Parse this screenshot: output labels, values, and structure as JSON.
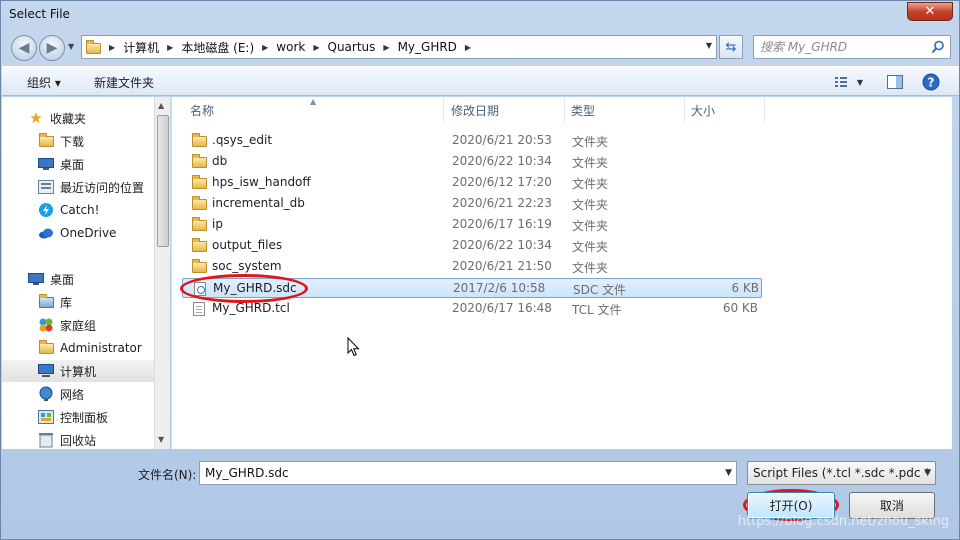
{
  "window": {
    "title": "Select File",
    "close_glyph": "✕"
  },
  "address": {
    "crumbs": [
      "计算机",
      "本地磁盘 (E:)",
      "work",
      "Quartus",
      "My_GHRD"
    ],
    "search_placeholder": "搜索 My_GHRD"
  },
  "toolbar": {
    "organize": "组织 ▾",
    "new_folder": "新建文件夹"
  },
  "nav": {
    "favorites": {
      "label": "收藏夹",
      "items": [
        "下载",
        "桌面",
        "最近访问的位置",
        "Catch!",
        "OneDrive"
      ]
    },
    "desktop": {
      "label": "桌面",
      "items": [
        "库",
        "家庭组",
        "Administrator",
        "计算机",
        "网络",
        "控制面板",
        "回收站"
      ]
    }
  },
  "columns": {
    "name": "名称",
    "modified": "修改日期",
    "type": "类型",
    "size": "大小"
  },
  "files": [
    {
      "name": ".qsys_edit",
      "modified": "2020/6/21 20:53",
      "type": "文件夹",
      "size": "",
      "kind": "folder"
    },
    {
      "name": "db",
      "modified": "2020/6/22 10:34",
      "type": "文件夹",
      "size": "",
      "kind": "folder"
    },
    {
      "name": "hps_isw_handoff",
      "modified": "2020/6/12 17:20",
      "type": "文件夹",
      "size": "",
      "kind": "folder"
    },
    {
      "name": "incremental_db",
      "modified": "2020/6/21 22:23",
      "type": "文件夹",
      "size": "",
      "kind": "folder"
    },
    {
      "name": "ip",
      "modified": "2020/6/17 16:19",
      "type": "文件夹",
      "size": "",
      "kind": "folder"
    },
    {
      "name": "output_files",
      "modified": "2020/6/22 10:34",
      "type": "文件夹",
      "size": "",
      "kind": "folder"
    },
    {
      "name": "soc_system",
      "modified": "2020/6/21 21:50",
      "type": "文件夹",
      "size": "",
      "kind": "folder"
    },
    {
      "name": "My_GHRD.sdc",
      "modified": "2017/2/6 10:58",
      "type": "SDC 文件",
      "size": "6 KB",
      "kind": "sdc"
    },
    {
      "name": "My_GHRD.tcl",
      "modified": "2020/6/17 16:48",
      "type": "TCL 文件",
      "size": "60 KB",
      "kind": "tcl"
    }
  ],
  "selected_file_index": 7,
  "bottom": {
    "filename_label": "文件名(N):",
    "filename_value": "My_GHRD.sdc",
    "filter_value": "Script Files (*.tcl *.sdc *.pdc *",
    "open_label": "打开(O)",
    "cancel_label": "取消"
  },
  "watermark": "https://blog.csdn.net/zhou_sking",
  "colors": {
    "annotation": "#e1141b",
    "selection": "#cce4fb",
    "accent": "#2f68b2"
  }
}
